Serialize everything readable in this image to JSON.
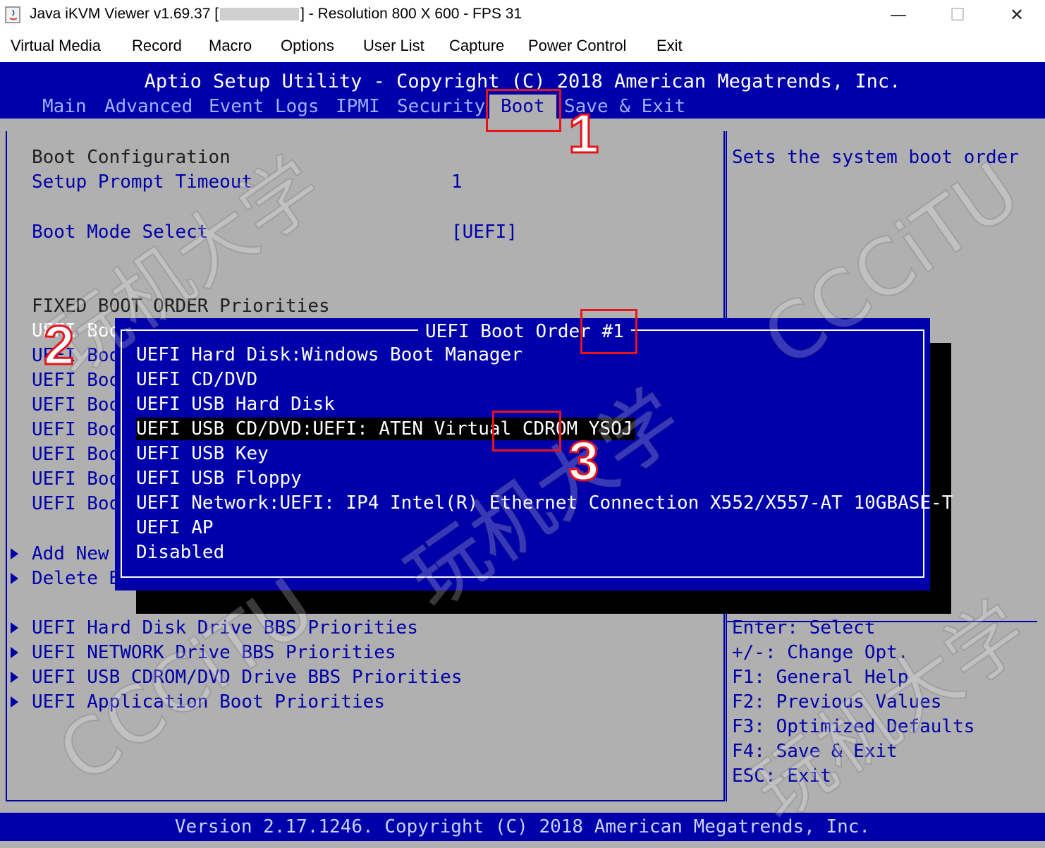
{
  "window": {
    "title_prefix": "Java iKVM Viewer v1.69.37 [",
    "title_suffix": "] - Resolution 800 X 600 - FPS 31",
    "minimize": "—",
    "maximize": "☐",
    "close": "✕"
  },
  "menubar": [
    "Virtual Media",
    "Record",
    "Macro",
    "Options",
    "User List",
    "Capture",
    "Power Control",
    "Exit"
  ],
  "bios": {
    "title": "Aptio Setup Utility - Copyright (C) 2018 American Megatrends, Inc.",
    "tabs": [
      "Main",
      "Advanced",
      "Event Logs",
      "IPMI",
      "Security",
      "Boot",
      "Save & Exit"
    ],
    "active_tab": "Boot",
    "left": {
      "boot_configuration": "Boot Configuration",
      "setup_prompt_timeout_label": "Setup Prompt Timeout",
      "setup_prompt_timeout_value": "1",
      "boot_mode_select_label": "Boot Mode Select",
      "boot_mode_select_value": "[UEFI]",
      "fixed_boot_order": "FIXED BOOT ORDER Priorities",
      "boot_rows": [
        "UEFI Boo",
        "UEFI Boo",
        "UEFI Boo",
        "UEFI Boo",
        "UEFI Boo",
        "UEFI Boo",
        "UEFI Boo",
        "UEFI Boo"
      ],
      "add_new": "Add New",
      "delete_b": "Delete B",
      "submenus": [
        "UEFI Hard Disk Drive BBS Priorities",
        "UEFI NETWORK Drive BBS Priorities",
        "UEFI USB CDROM/DVD Drive BBS Priorities",
        "UEFI Application Boot Priorities"
      ]
    },
    "help_text": "Sets the system boot order",
    "keys": [
      "Enter: Select",
      "+/-: Change Opt.",
      "F1: General Help",
      "F2: Previous Values",
      "F3: Optimized Defaults",
      "F4: Save & Exit",
      "ESC: Exit"
    ],
    "footer": "Version 2.17.1246. Copyright (C) 2018 American Megatrends, Inc."
  },
  "popup": {
    "title": "UEFI Boot Order #1",
    "items": [
      "UEFI Hard Disk:Windows Boot Manager",
      "UEFI CD/DVD",
      "UEFI USB Hard Disk",
      "UEFI USB CD/DVD:UEFI: ATEN Virtual CDROM YSOJ",
      "UEFI USB Key",
      "UEFI USB Floppy",
      "UEFI Network:UEFI: IP4 Intel(R) Ethernet Connection X552/X557-AT 10GBASE-T",
      "UEFI AP",
      "Disabled"
    ],
    "selected_index": 3
  },
  "annotations": [
    "1",
    "2",
    "3"
  ],
  "watermarks": [
    "玩机大学",
    "CCCiTU"
  ],
  "colors": {
    "bios_blue": "#0000aa",
    "bios_gray": "#b0b0b0",
    "annotation_red": "#e8141c"
  }
}
